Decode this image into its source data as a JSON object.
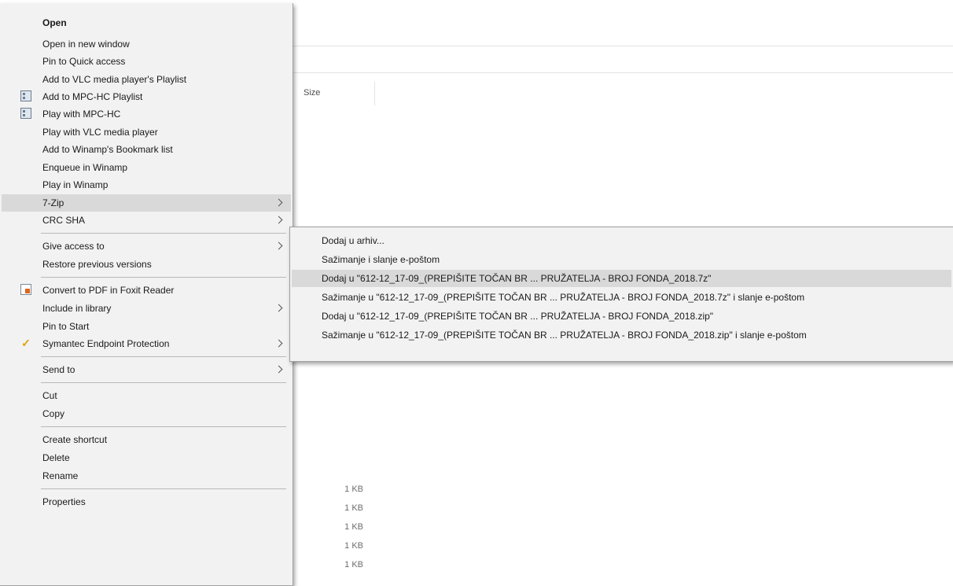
{
  "explorer": {
    "column_size_header": "Size",
    "sizes": [
      "1 KB",
      "1 KB",
      "1 KB",
      "1 KB",
      "1 KB"
    ]
  },
  "context_menu": {
    "items": [
      {
        "label": "Open"
      },
      {
        "label": "Open in new window"
      },
      {
        "label": "Pin to Quick access"
      },
      {
        "label": "Add to VLC media player's Playlist"
      },
      {
        "label": "Add to MPC-HC Playlist",
        "icon": "mpc-hc-icon"
      },
      {
        "label": "Play with MPC-HC",
        "icon": "mpc-hc-icon"
      },
      {
        "label": "Play with VLC media player"
      },
      {
        "label": "Add to Winamp's Bookmark list"
      },
      {
        "label": "Enqueue in Winamp"
      },
      {
        "label": "Play in Winamp"
      },
      {
        "label": "7-Zip",
        "submenu": true
      },
      {
        "label": "CRC SHA",
        "submenu": true
      },
      {
        "label": "Give access to",
        "submenu": true
      },
      {
        "label": "Restore previous versions"
      },
      {
        "label": "Convert to PDF in Foxit Reader",
        "icon": "foxit-pdf-icon"
      },
      {
        "label": "Include in library",
        "submenu": true
      },
      {
        "label": "Pin to Start"
      },
      {
        "label": "Symantec Endpoint Protection",
        "icon": "symantec-check-icon",
        "submenu": true
      },
      {
        "label": "Send to",
        "submenu": true
      },
      {
        "label": "Cut"
      },
      {
        "label": "Copy"
      },
      {
        "label": "Create shortcut"
      },
      {
        "label": "Delete"
      },
      {
        "label": "Rename"
      },
      {
        "label": "Properties"
      }
    ]
  },
  "zip_submenu": {
    "items": [
      {
        "label": "Dodaj u arhiv..."
      },
      {
        "label": "Sažimanje i slanje e-poštom"
      },
      {
        "label": "Dodaj u \"612-12_17-09_(PREPIŠITE TOČAN BR ...  PRUŽATELJA - BROJ FONDA_2018.7z\""
      },
      {
        "label": "Sažimanje u \"612-12_17-09_(PREPIŠITE TOČAN BR ...  PRUŽATELJA - BROJ FONDA_2018.7z\" i slanje e-poštom"
      },
      {
        "label": "Dodaj u \"612-12_17-09_(PREPIŠITE TOČAN BR ... PRUŽATELJA - BROJ FONDA_2018.zip\""
      },
      {
        "label": "Sažimanje u \"612-12_17-09_(PREPIŠITE TOČAN BR ... PRUŽATELJA - BROJ FONDA_2018.zip\" i slanje e-poštom"
      }
    ]
  },
  "colors": {
    "menu_background": "#f2f2f2",
    "highlight": "#d9d9d9",
    "separator": "#b8b8b8"
  }
}
